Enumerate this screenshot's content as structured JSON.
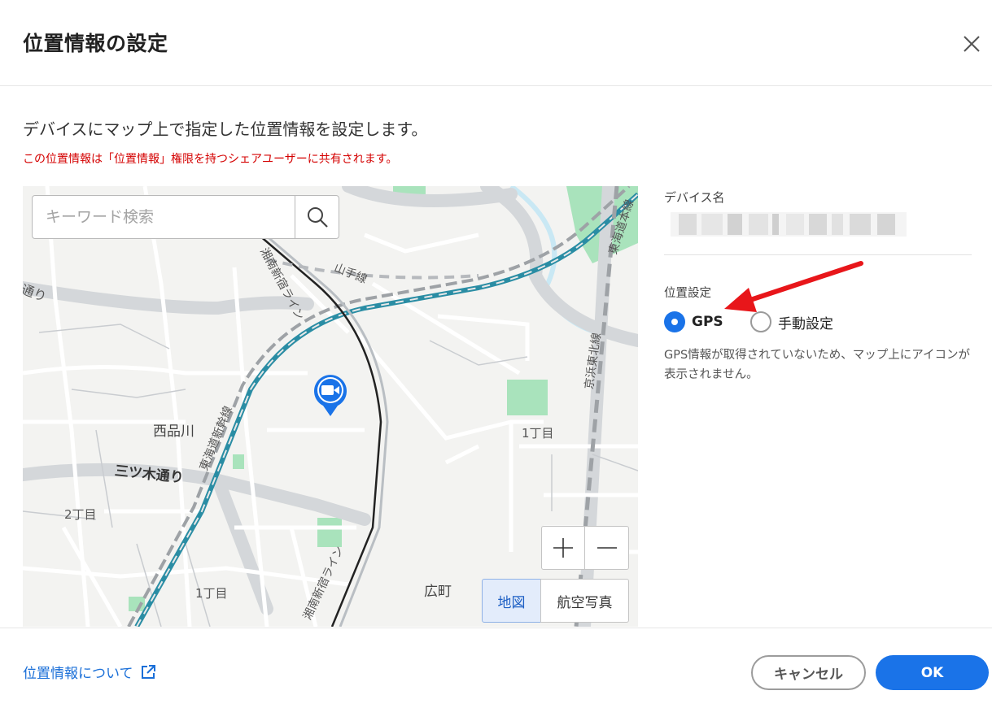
{
  "dialog": {
    "title": "位置情報の設定",
    "close_icon": "close-icon",
    "description": "デバイスにマップ上で指定した位置情報を設定します。",
    "warning": "この位置情報は「位置情報」権限を持つシェアユーザーに共有されます。"
  },
  "map": {
    "search": {
      "placeholder": "キーワード検索",
      "value": "",
      "icon": "search-icon"
    },
    "labels": {
      "nishishinagawa": "西品川",
      "mitsugi_dori": "三ツ木通り",
      "chome2": "2丁目",
      "chome1_left": "1丁目",
      "chome1_right": "1丁目",
      "hiromachi": "広町",
      "yamanote": "山手線",
      "tokaido_shinkansen": "東海道新幹線",
      "shonan_shinjuku_upper": "湘南新宿ライン",
      "shonan_shinjuku_lower": "湘南新宿ライン",
      "keihin_tohoku": "京浜東北線",
      "tokaido_main": "東海道本線",
      "dori_left": "通り"
    },
    "zoom": {
      "in_label": "+",
      "out_label": "−"
    },
    "map_type": {
      "map_label": "地図",
      "aerial_label": "航空写真",
      "selected": "地図"
    },
    "pin_icon": "video-camera-pin-icon"
  },
  "side": {
    "device_name_label": "デバイス名",
    "location_setting_label": "位置設定",
    "options": [
      {
        "label": "GPS",
        "checked": true
      },
      {
        "label": "手動設定",
        "checked": false
      }
    ],
    "note": "GPS情報が取得されていないため、マップ上にアイコンが表示されません。"
  },
  "footer": {
    "about_link": "位置情報について",
    "external_icon": "external-link-icon",
    "cancel_label": "キャンセル",
    "ok_label": "OK"
  },
  "colors": {
    "primary": "#1a73e8",
    "warning": "#d40000",
    "arrow": "#e8161a",
    "map_bg": "#f3f3f1"
  }
}
